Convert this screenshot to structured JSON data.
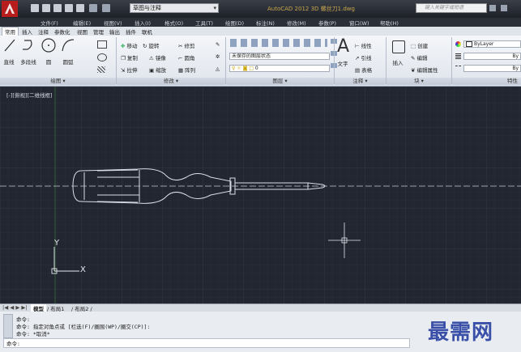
{
  "window": {
    "title": "AutoCAD 2012  3D 螺丝刀1.dwg",
    "workspace": "草图与注释",
    "search_placeholder": "键入关键字或短语"
  },
  "menu": [
    "文件(F)",
    "编辑(E)",
    "视图(V)",
    "插入(I)",
    "格式(O)",
    "工具(T)",
    "绘图(D)",
    "标注(N)",
    "修改(M)",
    "参数(P)",
    "窗口(W)",
    "帮助(H)"
  ],
  "ribbon_tabs": [
    "常用",
    "插入",
    "注释",
    "参数化",
    "视图",
    "管理",
    "输出",
    "插件",
    "联机"
  ],
  "ribbon": {
    "draw": {
      "title": "绘图 ▾",
      "line": "直线",
      "polyline": "多段线",
      "circle": "圆",
      "arc": "圆弧"
    },
    "modify": {
      "title": "修改 ▾",
      "move": "移动",
      "rotate": "旋转",
      "trim": "修剪",
      "copy": "复制",
      "mirror": "镜像",
      "fillet": "圆角",
      "stretch": "拉伸",
      "scale": "缩放",
      "array": "阵列"
    },
    "layers": {
      "title": "图层 ▾",
      "state": "未保存的图层状态",
      "current_layer": "0"
    },
    "annotation": {
      "title": "注释 ▾",
      "text": "文字",
      "linear": "线性",
      "leader": "引线",
      "table": "表格"
    },
    "block": {
      "title": "块 ▾",
      "insert": "插入",
      "create": "创建",
      "edit": "编辑",
      "edit_attr": "编辑属性"
    },
    "properties": {
      "title": "特性",
      "color": "ByLayer",
      "linetype_abbr1": "By",
      "linetype_abbr2": "By"
    }
  },
  "viewport_label": "[-][俯视][二维线框]",
  "axis": {
    "y": "Y",
    "x": "X"
  },
  "layout_tabs": [
    "模型",
    "布局1",
    "布局2"
  ],
  "command": {
    "lines": [
      "命令:",
      "命令: 指定对角点或 [栏选(F)/圈围(WP)/圈交(CP)]:",
      "命令: *取消*"
    ],
    "prompt": "命令:"
  },
  "watermark": "最需网",
  "colors": {
    "canvas": "#222630",
    "grid": "#2e3340",
    "drawing_line": "#d9dde5",
    "center_line": "#c9ccd3",
    "titlebar": "#1d2027",
    "watermark": "#3a4fa8"
  }
}
